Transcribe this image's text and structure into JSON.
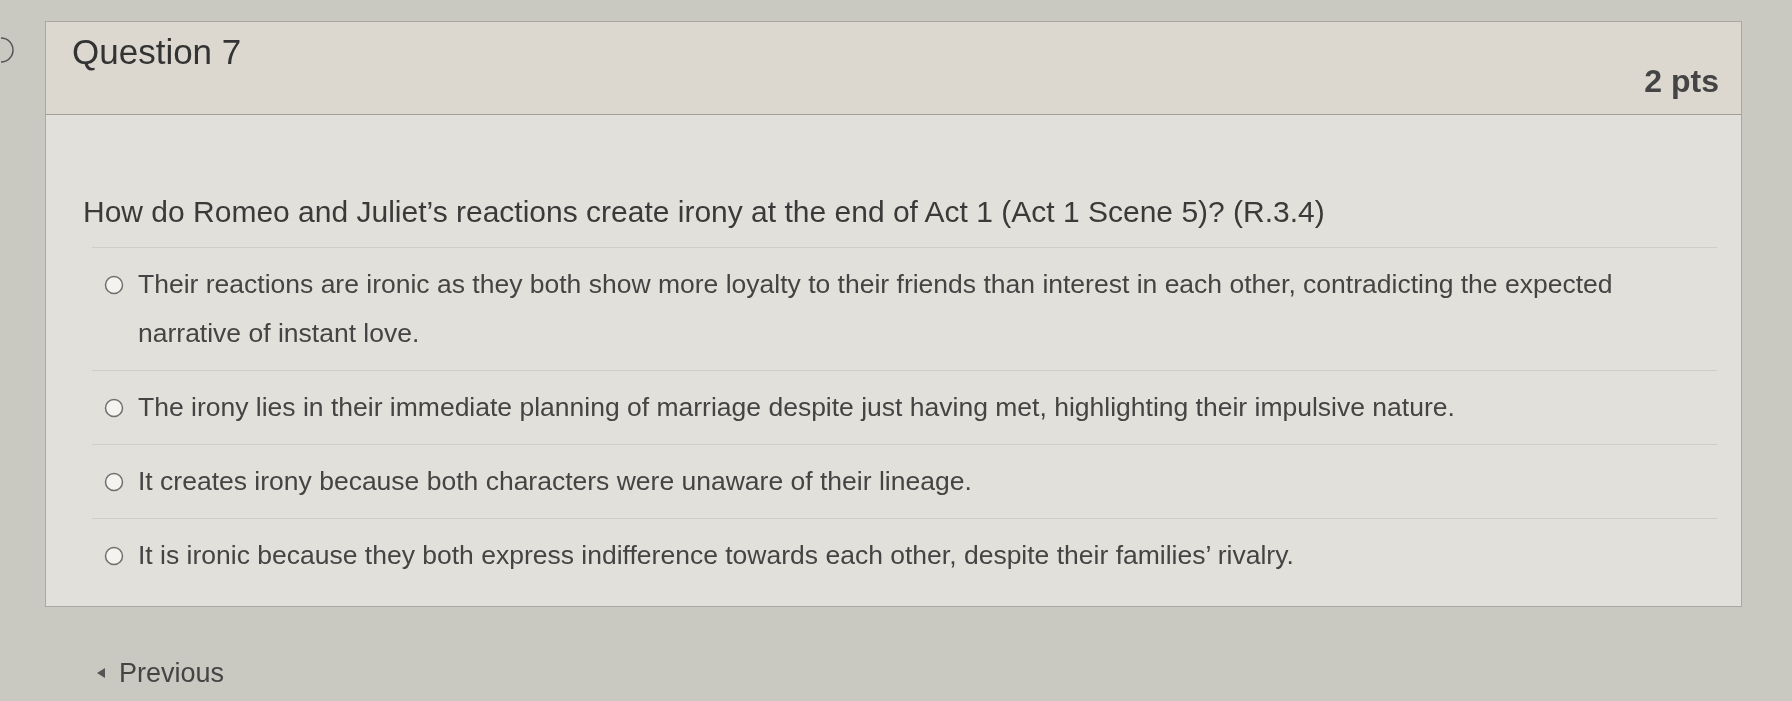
{
  "question": {
    "title": "Question 7",
    "points": "2 pts",
    "text": "How do Romeo and Juliet’s reactions create irony at the end of Act 1 (Act 1 Scene 5)? (R.3.4)",
    "answers": [
      {
        "text": "Their reactions are ironic as they both show more loyalty to their friends than interest in each other, contradicting the expected narrative of instant love.",
        "selected": false
      },
      {
        "text": "The irony lies in their immediate planning of marriage despite just having met, highlighting their impulsive nature.",
        "selected": false
      },
      {
        "text": "It creates irony because both characters were unaware of their lineage.",
        "selected": false
      },
      {
        "text": "It is ironic because they both express indifference towards each other, despite their families’ rivalry.",
        "selected": false
      }
    ]
  },
  "navigation": {
    "previous": "Previous"
  }
}
